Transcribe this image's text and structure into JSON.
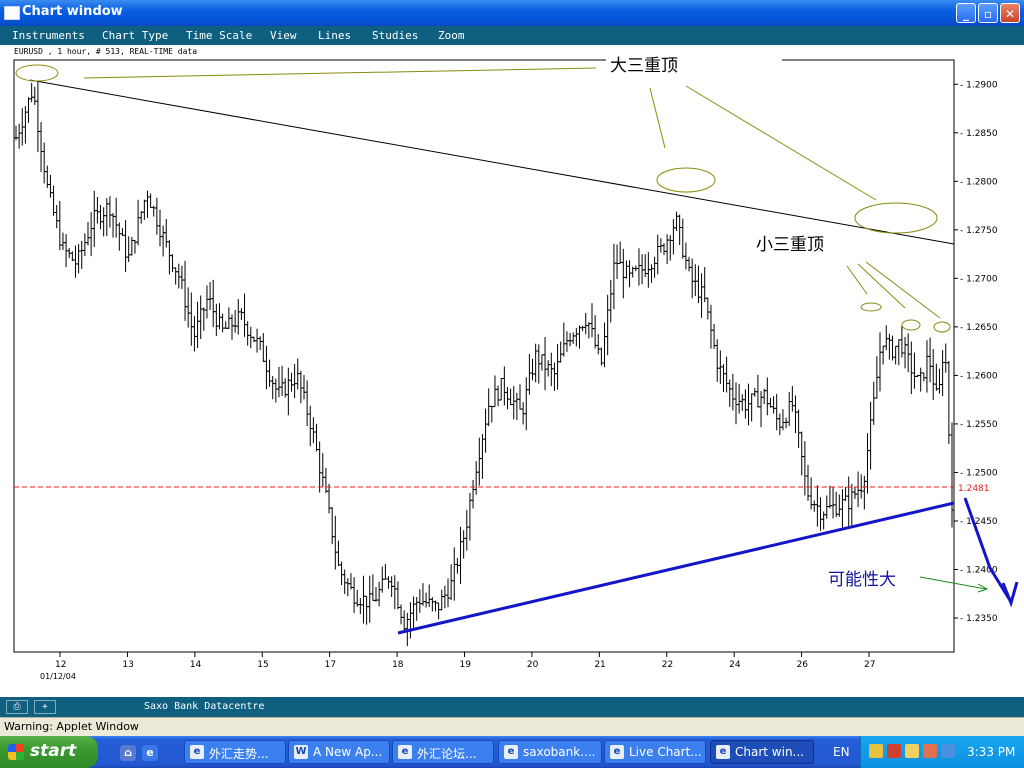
{
  "window": {
    "title": "Chart window",
    "minimize_label": "_",
    "maximize_label": "▫",
    "close_label": "✕"
  },
  "menu": {
    "items": [
      "Instruments",
      "Chart Type",
      "Time Scale",
      "View",
      "Lines",
      "Studies",
      "Zoom"
    ]
  },
  "chart_header": "EURUSD , 1 hour, # 513, REAL-TIME data",
  "chart_data": {
    "type": "bar",
    "instrument": "EURUSD",
    "interval": "1 hour",
    "bar_count_label": "# 513",
    "data_mode": "REAL-TIME data",
    "y_ticks": [
      "1.2900",
      "1.2850",
      "1.2800",
      "1.2750",
      "1.2700",
      "1.2650",
      "1.2600",
      "1.2550",
      "1.2500",
      "1.2450",
      "1.2400",
      "1.2350"
    ],
    "x_ticks": [
      "12",
      "13",
      "14",
      "15",
      "17",
      "18",
      "19",
      "20",
      "21",
      "22",
      "24",
      "26",
      "27"
    ],
    "x_sublabel": "01/12/04",
    "current_price": "1.2481",
    "ylim": [
      1.2315,
      1.2925
    ],
    "price_path": [
      [
        0,
        1.2845
      ],
      [
        0.018,
        1.2895
      ],
      [
        0.034,
        1.279
      ],
      [
        0.05,
        1.273
      ],
      [
        0.065,
        1.2715
      ],
      [
        0.082,
        1.276
      ],
      [
        0.1,
        1.2775
      ],
      [
        0.12,
        1.272
      ],
      [
        0.14,
        1.279
      ],
      [
        0.16,
        1.2735
      ],
      [
        0.175,
        1.27
      ],
      [
        0.19,
        1.264
      ],
      [
        0.205,
        1.268
      ],
      [
        0.22,
        1.2645
      ],
      [
        0.24,
        1.266
      ],
      [
        0.26,
        1.263
      ],
      [
        0.28,
        1.258
      ],
      [
        0.3,
        1.26
      ],
      [
        0.315,
        1.255
      ],
      [
        0.33,
        1.248
      ],
      [
        0.345,
        1.24
      ],
      [
        0.36,
        1.2375
      ],
      [
        0.38,
        1.2365
      ],
      [
        0.4,
        1.2395
      ],
      [
        0.415,
        1.2345
      ],
      [
        0.43,
        1.237
      ],
      [
        0.45,
        1.236
      ],
      [
        0.465,
        1.2385
      ],
      [
        0.48,
        1.244
      ],
      [
        0.49,
        1.25
      ],
      [
        0.505,
        1.257
      ],
      [
        0.52,
        1.259
      ],
      [
        0.54,
        1.256
      ],
      [
        0.555,
        1.262
      ],
      [
        0.575,
        1.26
      ],
      [
        0.59,
        1.264
      ],
      [
        0.61,
        1.266
      ],
      [
        0.625,
        1.261
      ],
      [
        0.64,
        1.272
      ],
      [
        0.655,
        1.27
      ],
      [
        0.67,
        1.271
      ],
      [
        0.69,
        1.273
      ],
      [
        0.705,
        1.276
      ],
      [
        0.72,
        1.27
      ],
      [
        0.735,
        1.268
      ],
      [
        0.75,
        1.261
      ],
      [
        0.765,
        1.258
      ],
      [
        0.78,
        1.257
      ],
      [
        0.8,
        1.258
      ],
      [
        0.815,
        1.255
      ],
      [
        0.83,
        1.257
      ],
      [
        0.845,
        1.248
      ],
      [
        0.86,
        1.246
      ],
      [
        0.875,
        1.2465
      ],
      [
        0.89,
        1.247
      ],
      [
        0.905,
        1.249
      ],
      [
        0.915,
        1.256
      ],
      [
        0.925,
        1.264
      ],
      [
        0.935,
        1.2625
      ],
      [
        0.945,
        1.2635
      ],
      [
        0.955,
        1.261
      ],
      [
        0.965,
        1.259
      ],
      [
        0.975,
        1.262
      ],
      [
        0.985,
        1.257
      ],
      [
        0.992,
        1.264
      ],
      [
        1.0,
        1.247
      ]
    ]
  },
  "annotations": {
    "big_triple_top": "大三重顶",
    "small_triple_top": "小三重顶",
    "high_probability": "可能性大"
  },
  "colors": {
    "chart_bg": "#ffffff",
    "window_bg": "#0e5f80",
    "resistance_line": "#000000",
    "support_line": "#1414c8",
    "projection_arrow": "#1414c8",
    "annotation_ellipse": "#8a8a10",
    "current_price_line": "#e02020",
    "green_arrow": "#1a8a1a"
  },
  "status": {
    "label": "Saxo Bank Datacentre"
  },
  "warning": "Warning: Applet Window",
  "taskbar": {
    "start_label": "start",
    "items": [
      {
        "label": "外汇走势...",
        "icon": "e",
        "active": false
      },
      {
        "label": "A New Ap...",
        "icon": "W",
        "active": false
      },
      {
        "label": "外汇论坛...",
        "icon": "e",
        "active": false
      },
      {
        "label": "saxobank....",
        "icon": "e",
        "active": false
      },
      {
        "label": "Live Chart...",
        "icon": "e",
        "active": false
      },
      {
        "label": "Chart win...",
        "icon": "e",
        "active": true
      }
    ],
    "language": "EN",
    "clock": "3:33 PM"
  }
}
